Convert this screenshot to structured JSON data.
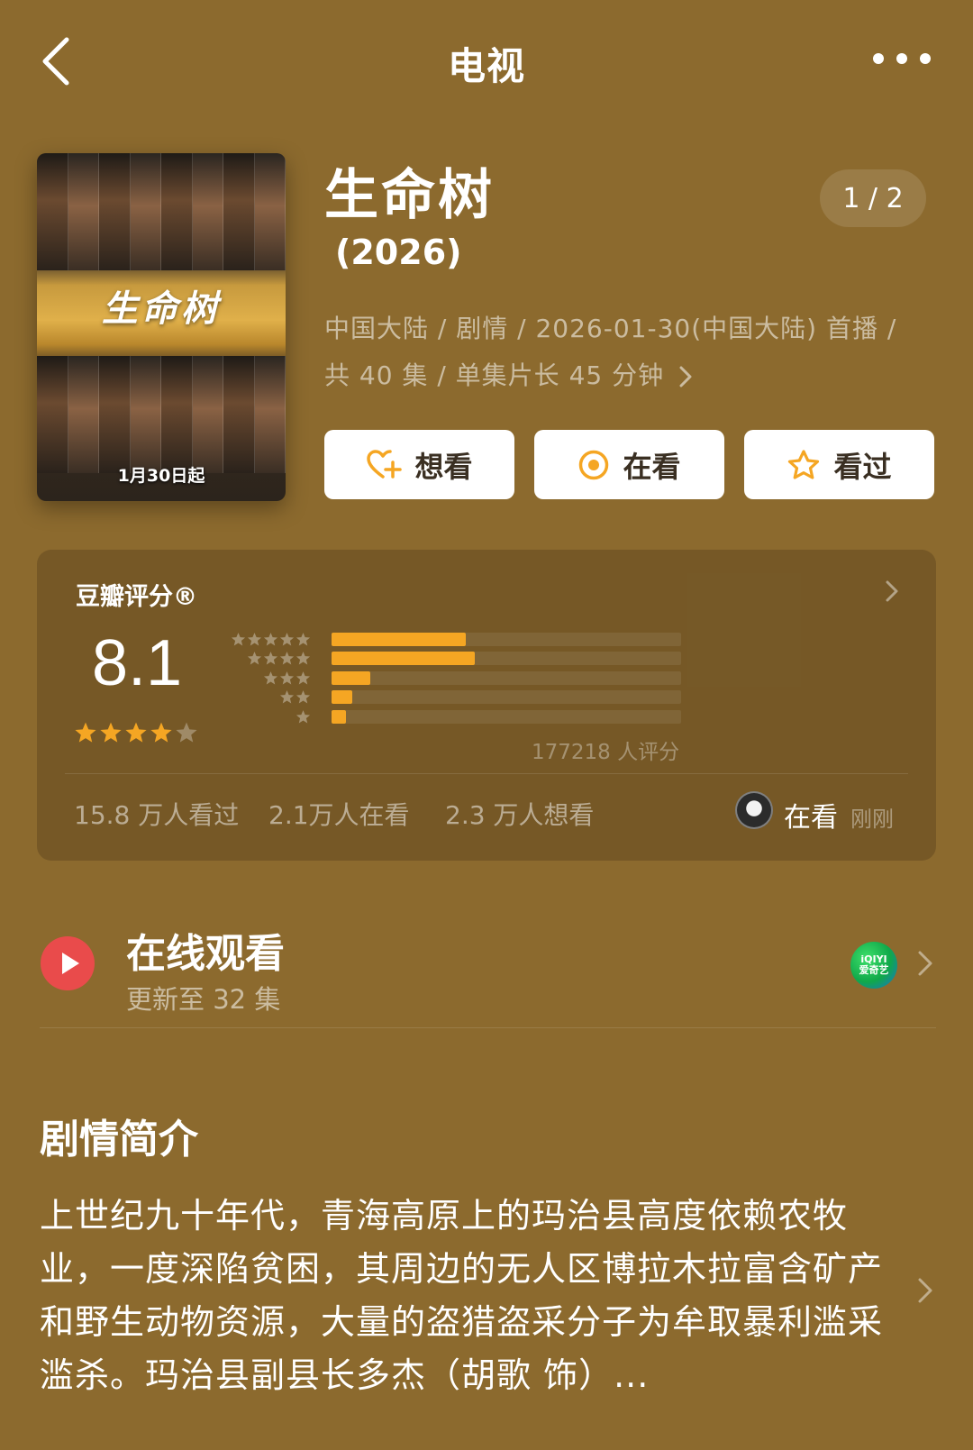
{
  "header": {
    "title": "电视",
    "back_icon": "chevron-left-icon",
    "more_icon": "more-horizontal-icon"
  },
  "poster": {
    "title_text": "生命树",
    "date_text": "1月30日起"
  },
  "show": {
    "title": "生命树",
    "year": "(2026)",
    "pager": "1 / 2",
    "meta_line1": "中国大陆 / 剧情 / 2026-01-30(中国大陆) 首播 /",
    "meta_line2": "共 40 集 / 单集片长 45 分钟"
  },
  "actions": {
    "want_label": "想看",
    "watching_label": "在看",
    "watched_label": "看过"
  },
  "rating": {
    "label": "豆瓣评分®",
    "score": "8.1",
    "star_rating": 4,
    "star_max": 5,
    "vote_count_text": "177218 人评分",
    "distribution": [
      {
        "stars": 5,
        "fraction": 0.385
      },
      {
        "stars": 4,
        "fraction": 0.41
      },
      {
        "stars": 3,
        "fraction": 0.11
      },
      {
        "stars": 2,
        "fraction": 0.06
      },
      {
        "stars": 1,
        "fraction": 0.04
      }
    ],
    "stats": {
      "watched": "15.8 万人看过",
      "watching": "2.1万人在看",
      "want": "2.3 万人想看"
    },
    "friend": {
      "status": "在看",
      "time": "刚刚"
    }
  },
  "watch_online": {
    "title": "在线观看",
    "subtitle": "更新至 32 集",
    "provider_line1": "iQIYI",
    "provider_line2": "爱奇艺"
  },
  "synopsis": {
    "heading": "剧情简介",
    "text": "上世纪九十年代，青海高原上的玛治县高度依赖农牧业，一度深陷贫困，其周边的无人区博拉木拉富含矿产和野生动物资源，大量的盗猎盗采分子为牟取暴利滥采滥杀。玛治县副县长多杰（胡歌 饰）..."
  },
  "colors": {
    "background": "#8c6a2e",
    "accent": "#f5a623",
    "play_red": "#e94b4b"
  }
}
